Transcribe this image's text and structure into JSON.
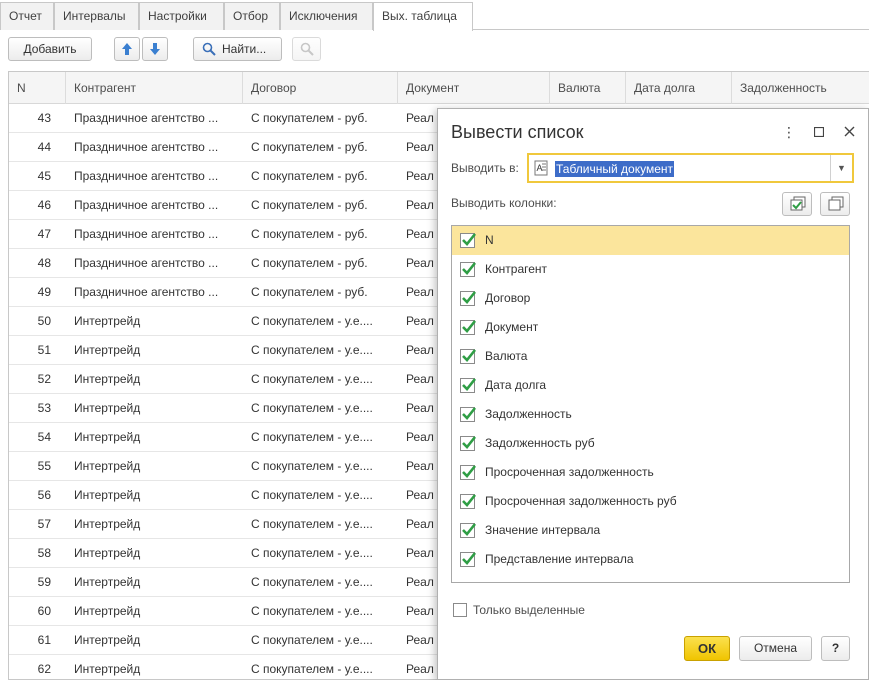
{
  "tabs": [
    {
      "label": "Отчет"
    },
    {
      "label": "Интервалы"
    },
    {
      "label": "Настройки"
    },
    {
      "label": "Отбор"
    },
    {
      "label": "Исключения"
    },
    {
      "label": "Вых. таблица",
      "active": true
    }
  ],
  "toolbar": {
    "add_label": "Добавить",
    "find_label": "Найти...",
    "move_up_icon": "arrow-up-icon",
    "move_down_icon": "arrow-down-icon",
    "find_icon": "magnifier-icon",
    "cancel_search_icon": "cancel-search-icon"
  },
  "table": {
    "columns": [
      "N",
      "Контрагент",
      "Договор",
      "Документ",
      "Валюта",
      "Дата долга",
      "Задолженность"
    ],
    "rows": [
      {
        "n": "43",
        "counterparty": "Праздничное агентство ...",
        "contract": "С покупателем - руб.",
        "document": "Реал"
      },
      {
        "n": "44",
        "counterparty": "Праздничное агентство ...",
        "contract": "С покупателем - руб.",
        "document": "Реал"
      },
      {
        "n": "45",
        "counterparty": "Праздничное агентство ...",
        "contract": "С покупателем - руб.",
        "document": "Реал"
      },
      {
        "n": "46",
        "counterparty": "Праздничное агентство ...",
        "contract": "С покупателем - руб.",
        "document": "Реал"
      },
      {
        "n": "47",
        "counterparty": "Праздничное агентство ...",
        "contract": "С покупателем - руб.",
        "document": "Реал"
      },
      {
        "n": "48",
        "counterparty": "Праздничное агентство ...",
        "contract": "С покупателем - руб.",
        "document": "Реал"
      },
      {
        "n": "49",
        "counterparty": "Праздничное агентство ...",
        "contract": "С покупателем - руб.",
        "document": "Реал"
      },
      {
        "n": "50",
        "counterparty": "Интертрейд",
        "contract": "С покупателем - у.е....",
        "document": "Реал"
      },
      {
        "n": "51",
        "counterparty": "Интертрейд",
        "contract": "С покупателем - у.е....",
        "document": "Реал"
      },
      {
        "n": "52",
        "counterparty": "Интертрейд",
        "contract": "С покупателем - у.е....",
        "document": "Реал"
      },
      {
        "n": "53",
        "counterparty": "Интертрейд",
        "contract": "С покупателем - у.е....",
        "document": "Реал"
      },
      {
        "n": "54",
        "counterparty": "Интертрейд",
        "contract": "С покупателем - у.е....",
        "document": "Реал"
      },
      {
        "n": "55",
        "counterparty": "Интертрейд",
        "contract": "С покупателем - у.е....",
        "document": "Реал"
      },
      {
        "n": "56",
        "counterparty": "Интертрейд",
        "contract": "С покупателем - у.е....",
        "document": "Реал"
      },
      {
        "n": "57",
        "counterparty": "Интертрейд",
        "contract": "С покупателем - у.е....",
        "document": "Реал"
      },
      {
        "n": "58",
        "counterparty": "Интертрейд",
        "contract": "С покупателем - у.е....",
        "document": "Реал"
      },
      {
        "n": "59",
        "counterparty": "Интертрейд",
        "contract": "С покупателем - у.е....",
        "document": "Реал"
      },
      {
        "n": "60",
        "counterparty": "Интертрейд",
        "contract": "С покупателем - у.е....",
        "document": "Реал"
      },
      {
        "n": "61",
        "counterparty": "Интертрейд",
        "contract": "С покупателем - у.е....",
        "document": "Реал"
      },
      {
        "n": "62",
        "counterparty": "Интертрейд",
        "contract": "С покупателем - у.е....",
        "document": "Реал"
      }
    ]
  },
  "dialog": {
    "title": "Вывести список",
    "more_icon": "more-vertical-icon",
    "maximize_icon": "maximize-icon",
    "close_icon": "close-icon",
    "output_to_label": "Выводить в:",
    "output_to_value": "Табличный документ",
    "output_to_icon": "spreadsheet-document-icon",
    "columns_label": "Выводить колонки:",
    "check_all_icon": "check-all-icon",
    "uncheck_all_icon": "uncheck-all-icon",
    "columns": [
      {
        "label": "N",
        "checked": true,
        "selected": true
      },
      {
        "label": "Контрагент",
        "checked": true
      },
      {
        "label": "Договор",
        "checked": true
      },
      {
        "label": "Документ",
        "checked": true
      },
      {
        "label": "Валюта",
        "checked": true
      },
      {
        "label": "Дата долга",
        "checked": true
      },
      {
        "label": "Задолженность",
        "checked": true
      },
      {
        "label": "Задолженность руб",
        "checked": true
      },
      {
        "label": "Просроченная задолженность",
        "checked": true
      },
      {
        "label": "Просроченная задолженность руб",
        "checked": true
      },
      {
        "label": "Значение интервала",
        "checked": true
      },
      {
        "label": "Представление интервала",
        "checked": true
      }
    ],
    "only_selected_label": "Только выделенные",
    "only_selected_checked": false,
    "ok_label": "ОК",
    "cancel_label": "Отмена",
    "help_label": "?"
  },
  "colors": {
    "accent_yellow": "#f0c400",
    "selection_row": "#fbe59c",
    "check_green": "#2f9e45",
    "text_highlight": "#3d6cc8"
  }
}
